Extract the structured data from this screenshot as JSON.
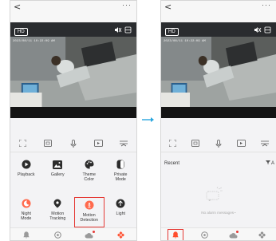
{
  "arrow": {
    "label": "→"
  },
  "left": {
    "topbar": {
      "back": "<",
      "more": "···"
    },
    "video": {
      "quality": "HD",
      "timestamp": "2023/08/11 10:22:09 AM"
    },
    "controls": [
      "fullscreen-icon",
      "screenshot-icon",
      "mic-icon",
      "record-icon",
      "more-icon"
    ],
    "tiles_row1": [
      {
        "label": "Playback",
        "icon": "play-icon"
      },
      {
        "label": "Gallery",
        "icon": "image-icon"
      },
      {
        "label": "Theme\nColor",
        "icon": "palette-icon"
      },
      {
        "label": "Private\nMode",
        "icon": "shield-icon"
      }
    ],
    "tiles_row2": [
      {
        "label": "Night\nMode",
        "icon": "night-icon",
        "color": "#ff6a4d"
      },
      {
        "label": "Motion\nTracking",
        "icon": "location-icon"
      },
      {
        "label": "Motion\nDetection",
        "icon": "motion-icon",
        "color": "#ff6a4d",
        "highlighted": true
      },
      {
        "label": "Light",
        "icon": "light-icon"
      }
    ],
    "nav": [
      "bell-icon",
      "settings-icon",
      "cloud-icon",
      "apps-icon"
    ]
  },
  "right": {
    "topbar": {
      "back": "<",
      "more": "···"
    },
    "video": {
      "quality": "HD",
      "timestamp": "2023/08/11 10:22:09 AM"
    },
    "controls": [
      "fullscreen-icon",
      "screenshot-icon",
      "mic-icon",
      "record-icon",
      "more-icon"
    ],
    "recent": {
      "title": "Recent",
      "all_label": "A",
      "empty_text": "No alarm messages~"
    },
    "nav": [
      "bell-icon",
      "settings-icon",
      "cloud-icon",
      "apps-icon"
    ]
  },
  "colors": {
    "accent": "#e53935",
    "brand_orange": "#ff6a4d",
    "arrow": "#29a6de"
  }
}
